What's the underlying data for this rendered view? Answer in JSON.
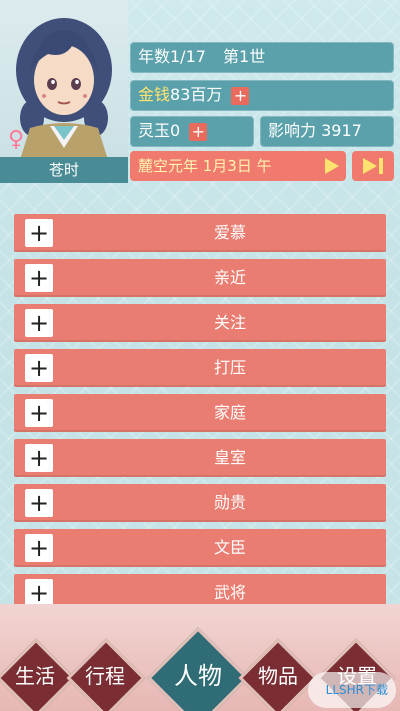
{
  "character": {
    "name": "苍时",
    "gender_icon": "female-icon"
  },
  "stats": {
    "year_text": "年数1/17",
    "generation_text": "第1世",
    "money_label": "金钱",
    "money_value": "83百万",
    "jade_text": "灵玉0",
    "influence_text": "影响力 3917",
    "plus_label": "+"
  },
  "date_text": "麓空元年 1月3日 午",
  "list": [
    {
      "label": "爱慕"
    },
    {
      "label": "亲近"
    },
    {
      "label": "关注"
    },
    {
      "label": "打压"
    },
    {
      "label": "家庭"
    },
    {
      "label": "皇室"
    },
    {
      "label": "勋贵"
    },
    {
      "label": "文臣"
    },
    {
      "label": "武将"
    }
  ],
  "nav": {
    "items": [
      "生活",
      "行程",
      "人物",
      "物品",
      "设置"
    ],
    "active": "人物"
  },
  "watermark": "LLSHR下载"
}
